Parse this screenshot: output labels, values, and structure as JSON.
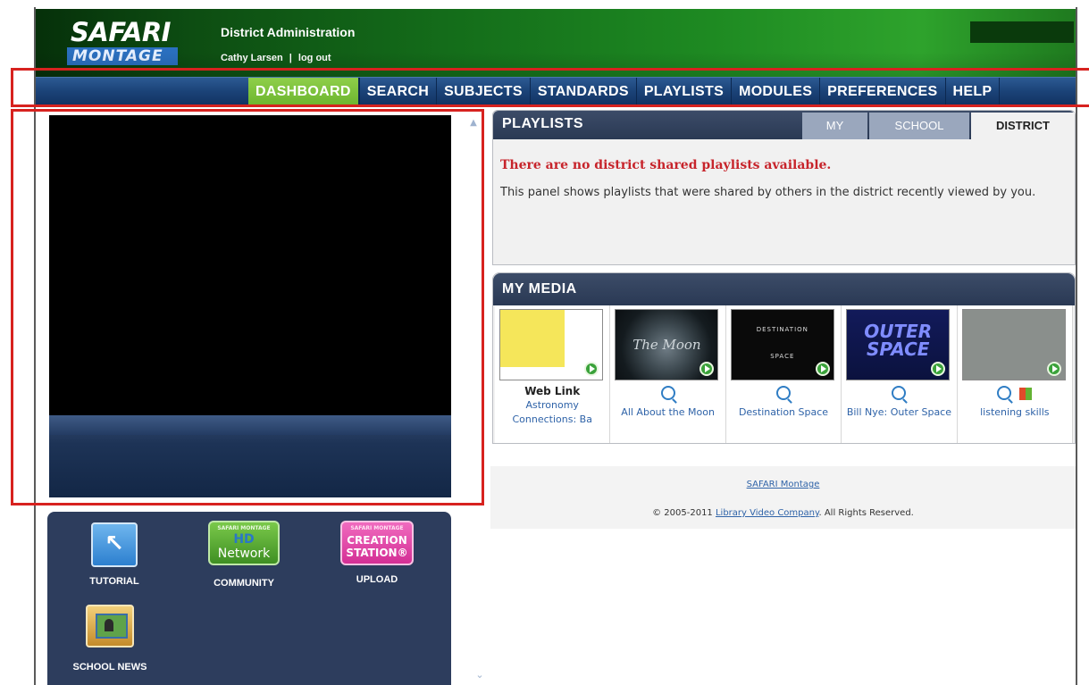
{
  "header": {
    "logo_top": "SAFARI",
    "logo_bottom": "MONTAGE",
    "title": "District Administration",
    "user_name": "Cathy Larsen",
    "separator": "|",
    "logout_label": "log out"
  },
  "nav": {
    "items": [
      {
        "label": "DASHBOARD",
        "active": true
      },
      {
        "label": "SEARCH"
      },
      {
        "label": "SUBJECTS"
      },
      {
        "label": "STANDARDS"
      },
      {
        "label": "PLAYLISTS"
      },
      {
        "label": "MODULES"
      },
      {
        "label": "PREFERENCES"
      },
      {
        "label": "HELP"
      }
    ]
  },
  "tools": {
    "tutorial_label": "TUTORIAL",
    "community_label": "COMMUNITY",
    "community_icon": {
      "small": "SAFARI MONTAGE",
      "big1": "HD",
      "big2": "Network"
    },
    "upload_label": "UPLOAD",
    "upload_icon": {
      "small": "SAFARI MONTAGE",
      "line1": "CREATION",
      "line2": "STATION®"
    },
    "school_news_label": "SCHOOL NEWS"
  },
  "playlists": {
    "title": "PLAYLISTS",
    "tabs": [
      "MY",
      "SCHOOL",
      "DISTRICT"
    ],
    "selected_tab": "DISTRICT",
    "empty_title": "There are no district shared playlists available.",
    "empty_body": "This panel shows playlists that were shared by others in the district recently viewed by you."
  },
  "my_media": {
    "title": "MY MEDIA",
    "items": [
      {
        "kind": "Web Link",
        "label": "Astronomy Connections: Ba"
      },
      {
        "label": "All About the Moon",
        "thumb_text": "The Moon"
      },
      {
        "label": "Destination Space",
        "thumb_text_1": "DESTINATION",
        "thumb_text_2": "SPACE"
      },
      {
        "label": "Bill Nye: Outer Space",
        "thumb_text": "OUTER SPACE"
      },
      {
        "label": "listening skills"
      }
    ]
  },
  "footer": {
    "link": "SAFARI Montage",
    "copyright_prefix": "© 2005-2011",
    "company": "Library Video Company",
    "copyright_suffix": ". All Rights Reserved."
  },
  "colors": {
    "header_green": "#1e8a22",
    "nav_blue": "#1b4378",
    "active_tab_green": "#6cb52f",
    "annotation_red": "#d7221f",
    "panel_header": "#2a3954",
    "alert_red": "#c7242b",
    "link_blue": "#2f63a8"
  },
  "icons": {
    "tutorial": "cursor-icon",
    "community": "hd-network-icon",
    "upload": "creation-station-icon",
    "school_news": "school-news-icon",
    "play": "play-icon",
    "preview": "magnifier-icon",
    "windows": "windows-logo-icon"
  }
}
